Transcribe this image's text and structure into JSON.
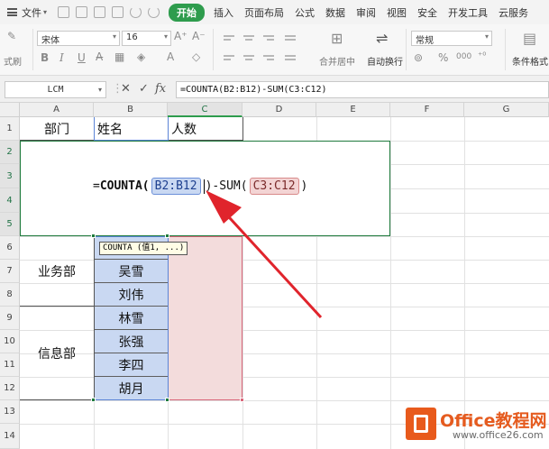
{
  "menu": {
    "file_label": "文件",
    "tabs": [
      "开始",
      "插入",
      "页面布局",
      "公式",
      "数据",
      "审阅",
      "视图",
      "安全",
      "开发工具",
      "云服务"
    ]
  },
  "ribbon": {
    "font_name": "宋体",
    "font_size": "16",
    "number_format": "常规",
    "merge_label": "合并居中",
    "wrap_label": "自动换行",
    "cond_format_label": "条件格式",
    "format_brush_label": "式刷",
    "bold": "B",
    "italic": "I",
    "underline": "U",
    "grow_font": "A⁺",
    "shrink_font": "A⁻",
    "percent": "%",
    "thousands": "000"
  },
  "formula_bar": {
    "name_box": "LCM",
    "cancel": "✕",
    "confirm": "✓",
    "fx": "fx",
    "formula": "=COUNTA(B2:B12)-SUM(C3:C12)"
  },
  "columns": [
    "A",
    "B",
    "C",
    "D",
    "E",
    "F",
    "G"
  ],
  "rows": [
    "1",
    "2",
    "3",
    "4",
    "5",
    "6",
    "7",
    "8",
    "9",
    "10",
    "11",
    "12",
    "13",
    "14"
  ],
  "headers": {
    "dept": "部门",
    "name": "姓名",
    "count": "人数"
  },
  "departments": [
    "业务部",
    "信息部"
  ],
  "names": [
    "吴雪",
    "刘伟",
    "林雪",
    "张强",
    "李四",
    "胡月"
  ],
  "editing_formula": {
    "prefix": "=",
    "fn": "COUNTA",
    "open": "(",
    "ref1": "B2:B12",
    "close": ")",
    "rest": "-SUM(",
    "ref2": "C3:C12",
    "end": ")"
  },
  "tooltip": "COUNTA (值1, ...)",
  "watermark": {
    "title": "Office教程网",
    "url": "www.office26.com"
  },
  "colors": {
    "accent_green": "#2e9c4d",
    "range_blue": "#c9d8f2",
    "range_pink": "#f3dcdc",
    "arrow_red": "#e0242c",
    "watermark_orange": "#e55b1f"
  }
}
